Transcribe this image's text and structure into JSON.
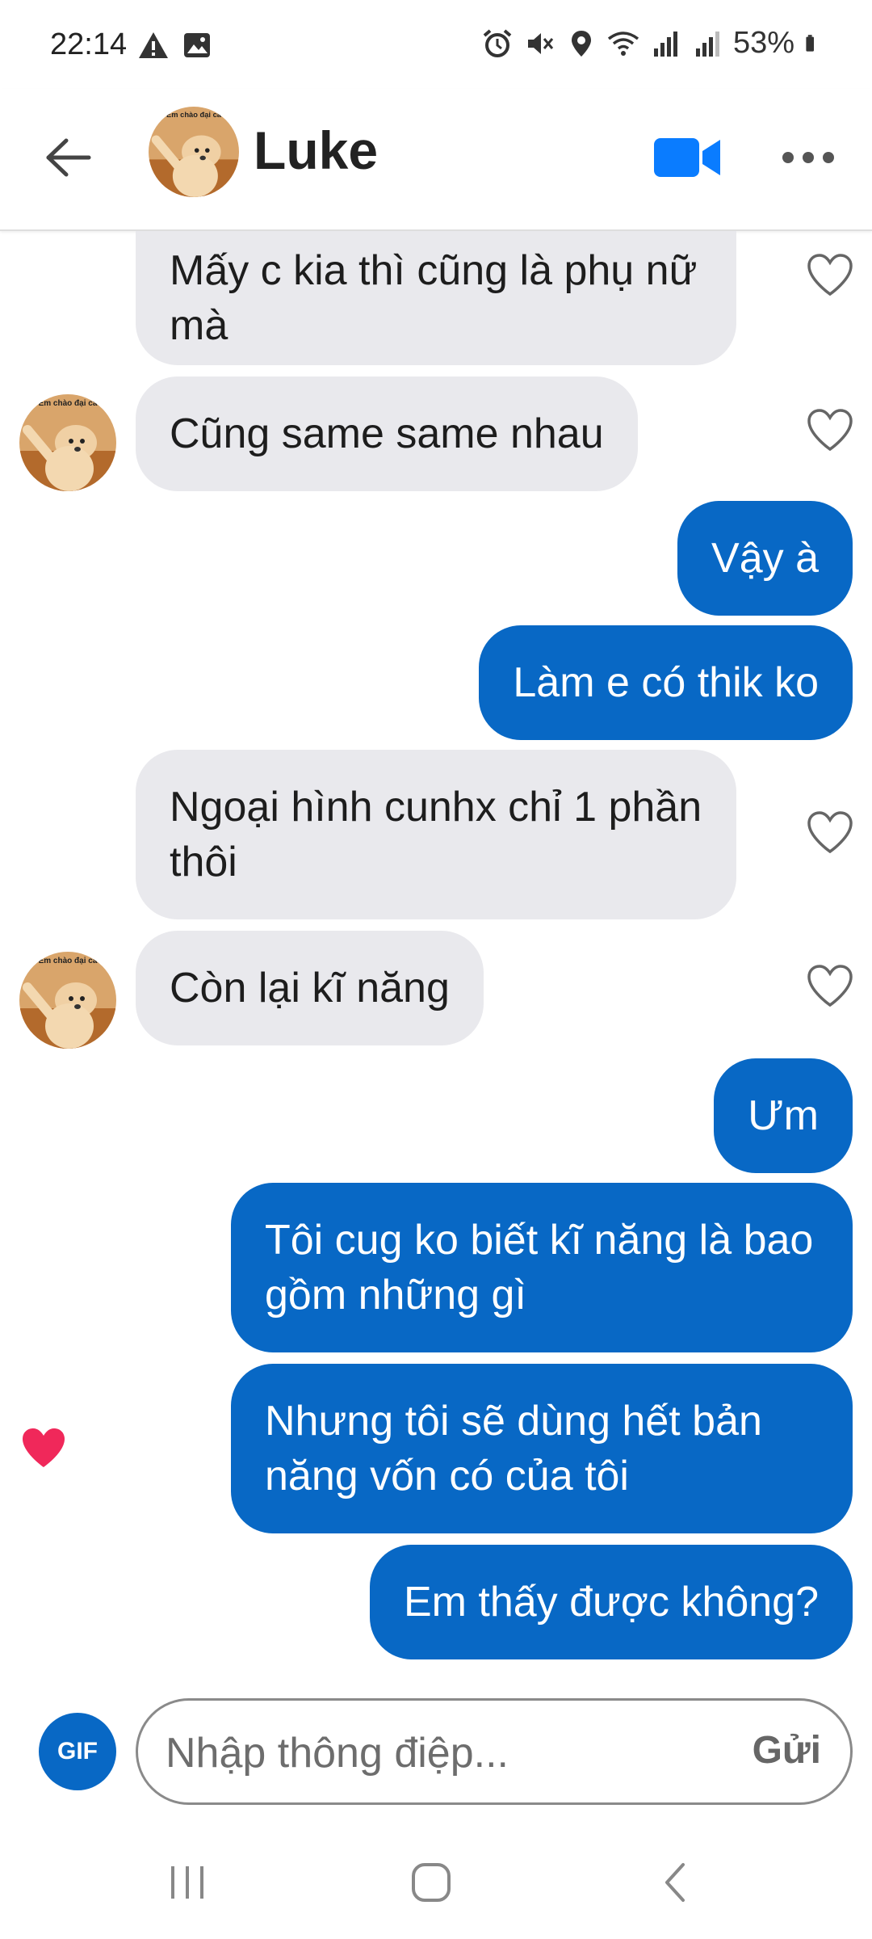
{
  "status_bar": {
    "time": "22:14",
    "battery": "53%"
  },
  "header": {
    "contact_name": "Luke",
    "avatar_caption": "Em chào đại ca"
  },
  "messages": [
    {
      "side": "in",
      "text": "Mấy c kia thì cũng là phụ nữ mà"
    },
    {
      "side": "in",
      "text": "Cũng same same nhau"
    },
    {
      "side": "out",
      "text": "Vậy à"
    },
    {
      "side": "out",
      "text": "Làm e có thik ko"
    },
    {
      "side": "in",
      "text": "Ngoại hình cunhx chỉ 1 phần thôi"
    },
    {
      "side": "in",
      "text": "Còn lại kĩ năng"
    },
    {
      "side": "out",
      "text": "Ưm"
    },
    {
      "side": "out",
      "text": "Tôi cug ko biết kĩ năng là bao gồm những gì"
    },
    {
      "side": "out",
      "text": "Nhưng tôi sẽ dùng hết bản năng vốn có của tôi"
    },
    {
      "side": "out",
      "text": "Em thấy được không?"
    }
  ],
  "composer": {
    "gif_label": "GIF",
    "placeholder": "Nhập thông điệp...",
    "send_label": "Gửi"
  },
  "colors": {
    "outgoing_bubble": "#0868c5",
    "incoming_bubble": "#e9e9ed",
    "liked_heart": "#f0285a"
  },
  "icons": [
    "back-arrow-icon",
    "video-camera-icon",
    "more-dots-icon",
    "heart-outline-icon",
    "heart-filled-icon",
    "recent-apps-icon",
    "home-icon",
    "nav-back-icon"
  ]
}
